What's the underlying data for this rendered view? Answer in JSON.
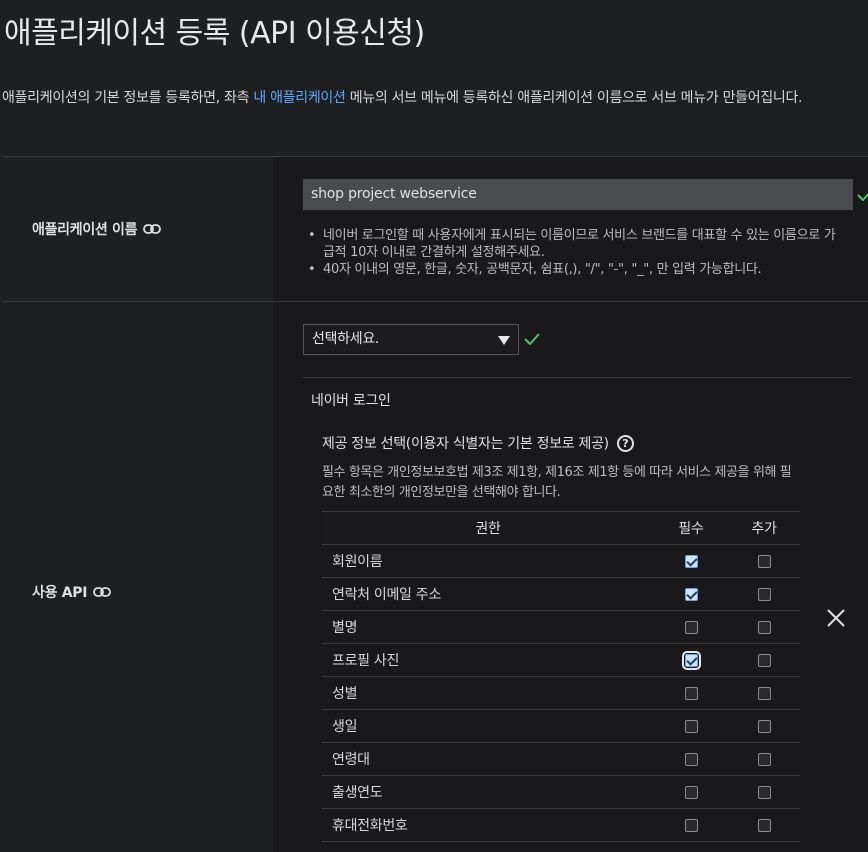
{
  "page": {
    "title": "애플리케이션 등록 (API 이용신청)",
    "intro_before_link": "애플리케이션의 기본 정보를 등록하면, 좌측 ",
    "intro_link": "내 애플리케이션",
    "intro_after_link": " 메뉴의 서브 메뉴에 등록하신 애플리케이션 이름으로 서브 메뉴가 만들어집니다."
  },
  "app_name_section": {
    "label": "애플리케이션 이름",
    "input_value": "shop project webservice",
    "notes": [
      "네이버 로그인할 때 사용자에게 표시되는 이름이므로 서비스 브랜드를 대표할 수 있는 이름으로 가급적 10자 이내로 간결하게 설정해주세요.",
      "40자 이내의 영문, 한글, 숫자, 공백문자, 쉼표(,), \"/\", \"-\", \"_\", 만 입력 가능합니다."
    ]
  },
  "api_section": {
    "label": "사용 API",
    "select_value": "선택하세요.",
    "api_name": "네이버 로그인",
    "info_title": "제공 정보 선택(이용자 식별자는 기본 정보로 제공)",
    "info_desc": "필수 항목은 개인정보보호법 제3조 제1항, 제16조 제1항 등에 따라 서비스 제공을 위해 필요한 최소한의 개인정보만을 선택해야 합니다.",
    "table": {
      "headers": [
        "권한",
        "필수",
        "추가"
      ],
      "rows": [
        {
          "name": "회원이름",
          "required": true,
          "additional": false
        },
        {
          "name": "연락처 이메일 주소",
          "required": true,
          "additional": false
        },
        {
          "name": "별명",
          "required": false,
          "additional": false
        },
        {
          "name": "프로필 사진",
          "required": true,
          "additional": false
        },
        {
          "name": "성별",
          "required": false,
          "additional": false
        },
        {
          "name": "생일",
          "required": false,
          "additional": false
        },
        {
          "name": "연령대",
          "required": false,
          "additional": false
        },
        {
          "name": "출생연도",
          "required": false,
          "additional": false
        },
        {
          "name": "휴대전화번호",
          "required": false,
          "additional": false
        }
      ]
    }
  },
  "colors": {
    "background": "#1e1f21",
    "link": "#5aa7ff",
    "valid_check": "#4cc46a"
  }
}
